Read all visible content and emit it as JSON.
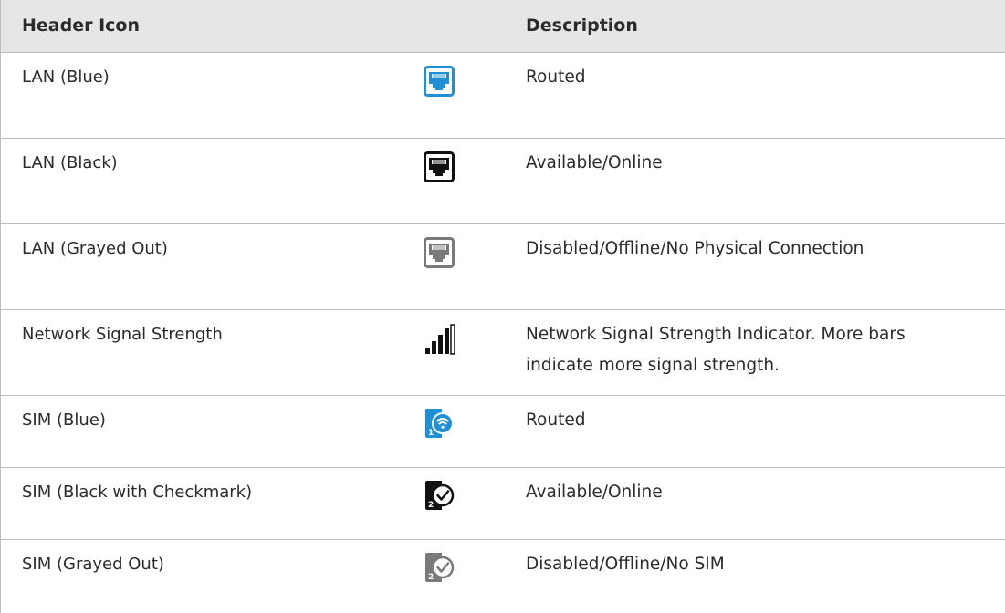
{
  "header": {
    "col1": "Header Icon",
    "col2": "Description"
  },
  "rows": [
    {
      "name": "LAN (Blue)",
      "icon": "lan-blue-icon",
      "description": "Routed",
      "color": "#1f8fd6"
    },
    {
      "name": "LAN (Black)",
      "icon": "lan-black-icon",
      "description": "Available/Online",
      "color": "#111111"
    },
    {
      "name": "LAN (Grayed Out)",
      "icon": "lan-gray-icon",
      "description": "Disabled/Offline/No Physical Connection",
      "color": "#7a7a7a"
    },
    {
      "name": "Network Signal Strength",
      "icon": "signal-bars-icon",
      "description_lines": [
        "Network Signal Strength Indicator. More bars",
        "indicate more signal strength."
      ]
    },
    {
      "name": "SIM (Blue)",
      "icon": "sim-blue-icon",
      "description": "Routed",
      "sim_number": "1",
      "color": "#1f8fd6"
    },
    {
      "name": "SIM (Black with Checkmark)",
      "icon": "sim-black-check-icon",
      "description": "Available/Online",
      "sim_number": "2",
      "color": "#111111"
    },
    {
      "name": "SIM (Grayed Out)",
      "icon": "sim-gray-check-icon",
      "description": "Disabled/Offline/No SIM",
      "sim_number": "2",
      "color": "#7a7a7a"
    }
  ]
}
